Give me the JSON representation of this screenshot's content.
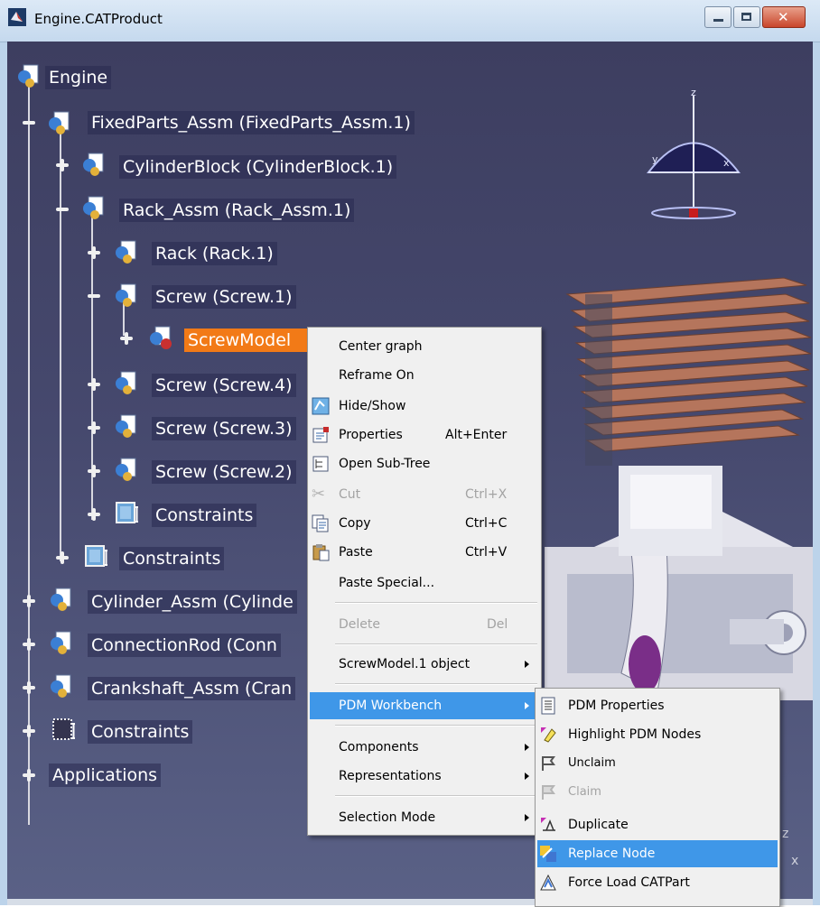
{
  "window": {
    "title": "Engine.CATProduct",
    "minimize_label": "minimize",
    "maximize_label": "maximize",
    "close_label": "close"
  },
  "tree": {
    "root": "Engine",
    "nodes": [
      {
        "label": "FixedParts_Assm (FixedParts_Assm.1)"
      },
      {
        "label": "CylinderBlock (CylinderBlock.1)"
      },
      {
        "label": "Rack_Assm (Rack_Assm.1)"
      },
      {
        "label": "Rack (Rack.1)"
      },
      {
        "label": "Screw (Screw.1)"
      },
      {
        "label": "ScrewModel"
      },
      {
        "label": "Screw (Screw.4)"
      },
      {
        "label": "Screw (Screw.3)"
      },
      {
        "label": "Screw (Screw.2)"
      },
      {
        "label": "Constraints"
      },
      {
        "label": "Constraints"
      },
      {
        "label": "Cylinder_Assm (Cylinde"
      },
      {
        "label": "ConnectionRod (Conn"
      },
      {
        "label": "Crankshaft_Assm (Cran"
      },
      {
        "label": "Constraints"
      },
      {
        "label": "Applications"
      }
    ]
  },
  "compass": {
    "x": "x",
    "y": "y",
    "z": "z"
  },
  "context_menu": {
    "items": [
      {
        "label": "Center graph",
        "accel": ""
      },
      {
        "label": "Reframe On",
        "accel": ""
      },
      {
        "label": "Hide/Show",
        "accel": ""
      },
      {
        "label": "Properties",
        "accel": "Alt+Enter"
      },
      {
        "label": "Open Sub-Tree",
        "accel": ""
      },
      {
        "label": "Cut",
        "accel": "Ctrl+X"
      },
      {
        "label": "Copy",
        "accel": "Ctrl+C"
      },
      {
        "label": "Paste",
        "accel": "Ctrl+V"
      },
      {
        "label": "Paste Special...",
        "accel": ""
      },
      {
        "label": "Delete",
        "accel": "Del"
      },
      {
        "label": "ScrewModel.1 object",
        "accel": ""
      },
      {
        "label": "PDM Workbench",
        "accel": ""
      },
      {
        "label": "Components",
        "accel": ""
      },
      {
        "label": "Representations",
        "accel": ""
      },
      {
        "label": "Selection Mode",
        "accel": ""
      }
    ]
  },
  "pdm_submenu": {
    "items": [
      {
        "label": "PDM Properties"
      },
      {
        "label": "Highlight PDM Nodes"
      },
      {
        "label": "Unclaim"
      },
      {
        "label": "Claim"
      },
      {
        "label": "Duplicate"
      },
      {
        "label": "Replace Node"
      },
      {
        "label": "Force Load CATPart"
      }
    ]
  },
  "colors": {
    "selection": "#f27a17",
    "menu_highlight": "#3f97e8",
    "viewport_top": "#3d3e60",
    "viewport_bottom": "#5a6186"
  }
}
